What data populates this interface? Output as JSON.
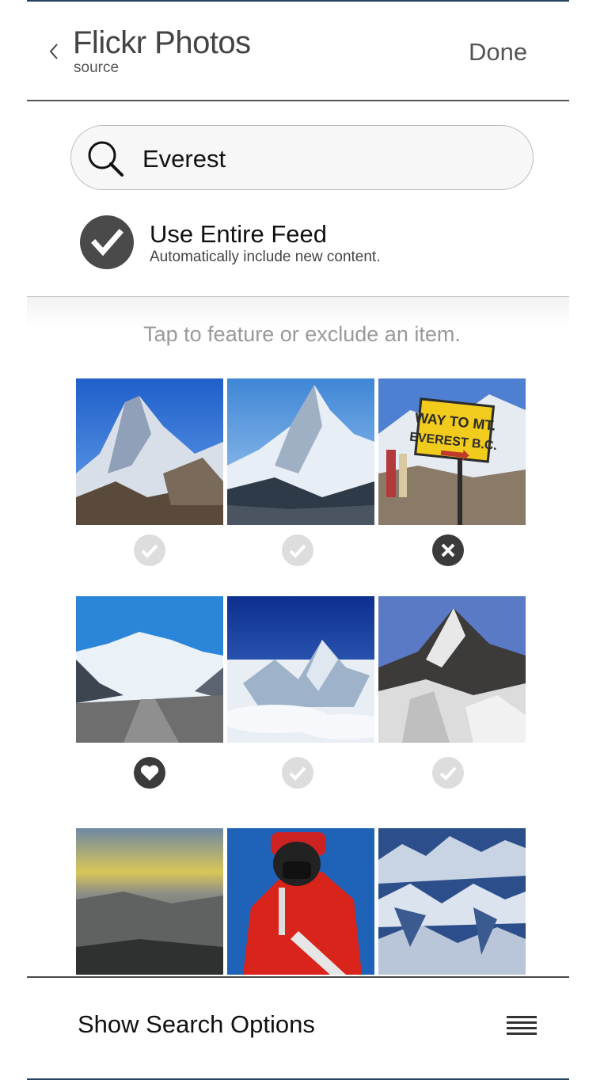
{
  "header": {
    "title": "Flickr Photos",
    "subtitle": "source",
    "done_label": "Done"
  },
  "search": {
    "value": "Everest",
    "icon": "search-icon"
  },
  "feed": {
    "title": "Use Entire Feed",
    "subtitle": "Automatically include new content.",
    "checked": true
  },
  "hint": "Tap to feature or exclude an item.",
  "photos": [
    {
      "scene": "snow-peak-blue-sky",
      "status": "included"
    },
    {
      "scene": "sharp-summit-blue-sky",
      "status": "included"
    },
    {
      "scene": "signpost-way-to-everest",
      "status": "excluded",
      "sign_text": [
        "WAY TO MT.",
        "EVEREST B.C."
      ]
    },
    {
      "scene": "glacier-road",
      "status": "featured"
    },
    {
      "scene": "peaks-above-clouds",
      "status": "included"
    },
    {
      "scene": "dark-summit",
      "status": "included"
    },
    {
      "scene": "sunset-ridge",
      "status": "none"
    },
    {
      "scene": "climber-red-suit",
      "status": "none"
    },
    {
      "scene": "aerial-range",
      "status": "none"
    }
  ],
  "footer": {
    "options_label": "Show Search Options",
    "menu_icon": "hamburger-icon"
  }
}
